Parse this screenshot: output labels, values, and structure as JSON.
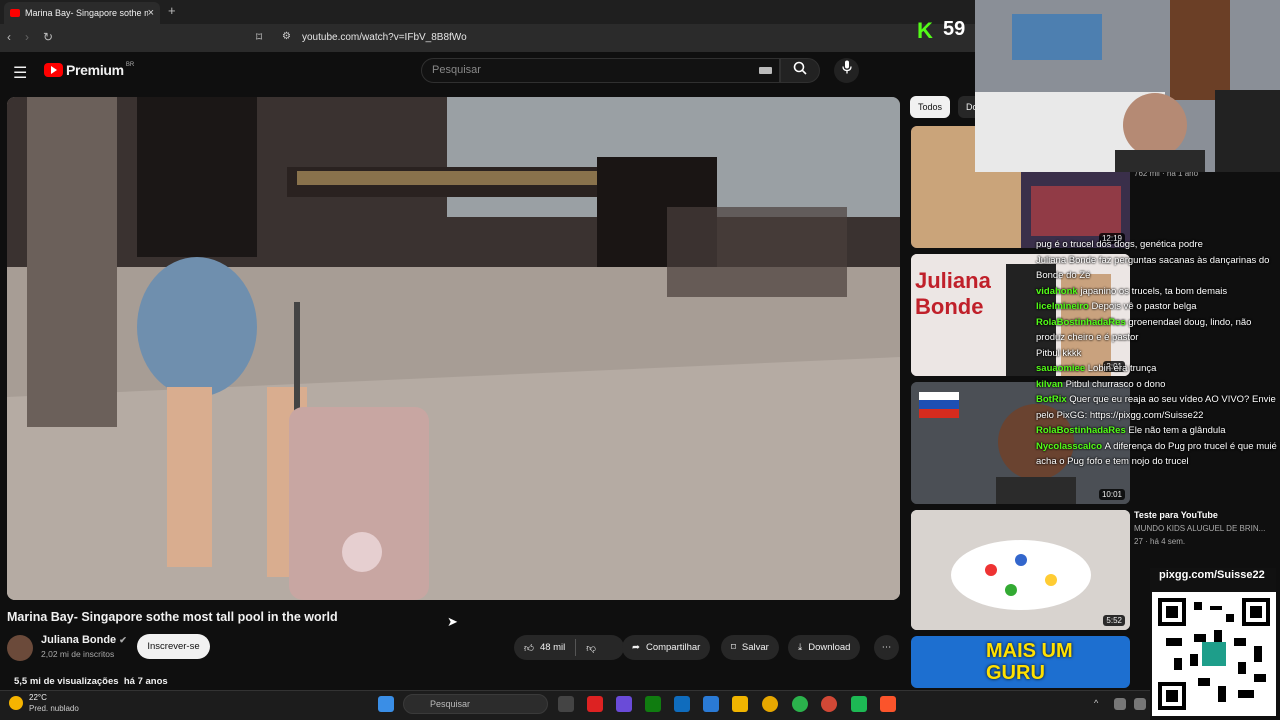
{
  "browser": {
    "tab_title": "Marina Bay- Singapore sothe mo",
    "tab_close": "×",
    "new_tab": "+",
    "back": "‹",
    "forward": "›",
    "reload": "↻",
    "url": "youtube.com/watch?v=IFbV_8B8fWo"
  },
  "youtube": {
    "logo_text": "Premium",
    "logo_region": "BR",
    "search_placeholder": "Pesquisar",
    "video": {
      "title": "Marina Bay- Singapore sothe most tall pool in the world",
      "channel": "Juliana Bonde",
      "subscribers": "2,02 mi de inscritos",
      "subscribe_label": "Inscrever-se",
      "likes": "48 mil",
      "share_label": "Compartilhar",
      "save_label": "Salvar",
      "download_label": "Download",
      "views": "5,5 mi de visualizações",
      "age": "há 7 anos"
    },
    "chips": [
      "Todos",
      "Do"
    ],
    "recommended": [
      {
        "duration": "12:19",
        "meta": "762 mil · há 1 ano"
      },
      {
        "duration": "2:01",
        "thumb_text": "Juliana Bonde"
      },
      {
        "duration": "10:01"
      },
      {
        "duration": "5:52",
        "title": "Teste para YouTube",
        "channel": "MUNDO KIDS ALUGUEL DE BRIN...",
        "meta": "27 · há 4 sem."
      },
      {
        "thumb_text": "MAIS UM GURU"
      }
    ]
  },
  "stream": {
    "viewer_count": "59",
    "kick_logo": "K",
    "chat": [
      {
        "user": "",
        "text": "pug é o trucel dos dogs, genética podre"
      },
      {
        "user": "",
        "text": "Juliana Bonde faz perguntas sacanas às dançarinas do Bonde do Zé"
      },
      {
        "user": "vidahonk",
        "text": "japanino os trucels, ta bom demais"
      },
      {
        "user": "licelmineiro",
        "text": "Depois vê o pastor belga"
      },
      {
        "user": "RolaBostinhadaRes",
        "text": "groenendael doug, lindo, não produz cheiro e é pastor"
      },
      {
        "user": "",
        "text": "Pitbul kkkk"
      },
      {
        "user": "sauaomiee",
        "text": "Lobin era trunça"
      },
      {
        "user": "kilvan",
        "text": "Pitbul churrasco o dono"
      },
      {
        "user": "BotRix",
        "text": "Quer que eu reaja ao seu vídeo AO VIVO? Envie pelo PixGG: https://pixgg.com/Suisse22"
      },
      {
        "user": "RolaBostinhadaRes",
        "text": "Ele não tem a glândula"
      },
      {
        "user": "Nycolasscalco",
        "text": "A diferença do Pug pro trucel é que muié acha o Pug fofo e tem nojo do trucel"
      }
    ],
    "pix_label": "pixgg.com/Suisse22"
  },
  "taskbar": {
    "temperature": "22°C",
    "weather": "Pred. nublado",
    "search_placeholder": "Pesquisar"
  }
}
